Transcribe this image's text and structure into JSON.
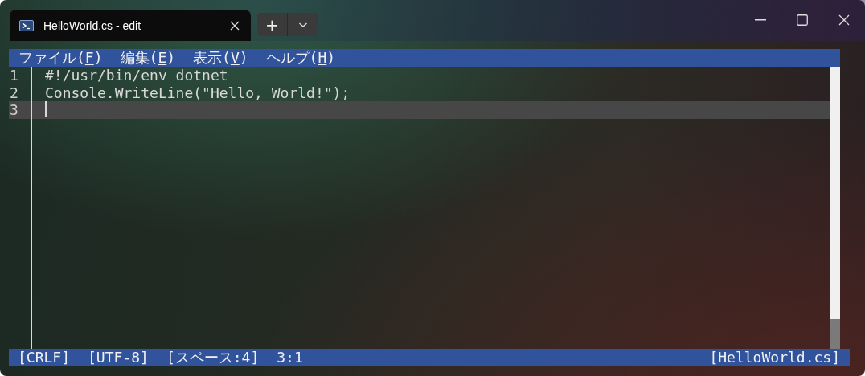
{
  "tabs": [
    {
      "title": "HelloWorld.cs - edit",
      "selected": true
    }
  ],
  "new_tab_button": "+",
  "menu": [
    {
      "before": "ファイル(",
      "accelerator": "F",
      "after": ")"
    },
    {
      "before": "編集(",
      "accelerator": "E",
      "after": ")"
    },
    {
      "before": "表示(",
      "accelerator": "V",
      "after": ")"
    },
    {
      "before": "ヘルプ(",
      "accelerator": "H",
      "after": ")"
    }
  ],
  "editor": {
    "lines": [
      {
        "number": "1",
        "text": "#!/usr/bin/env dotnet",
        "current": false
      },
      {
        "number": "2",
        "text": "Console.WriteLine(\"Hello, World!\");",
        "current": false
      },
      {
        "number": "3",
        "current": true
      }
    ]
  },
  "status_bar": {
    "left": [
      "[CRLF]",
      "[UTF-8]",
      "[スペース:4]",
      "3:1"
    ],
    "right": "[HelloWorld.cs]"
  }
}
